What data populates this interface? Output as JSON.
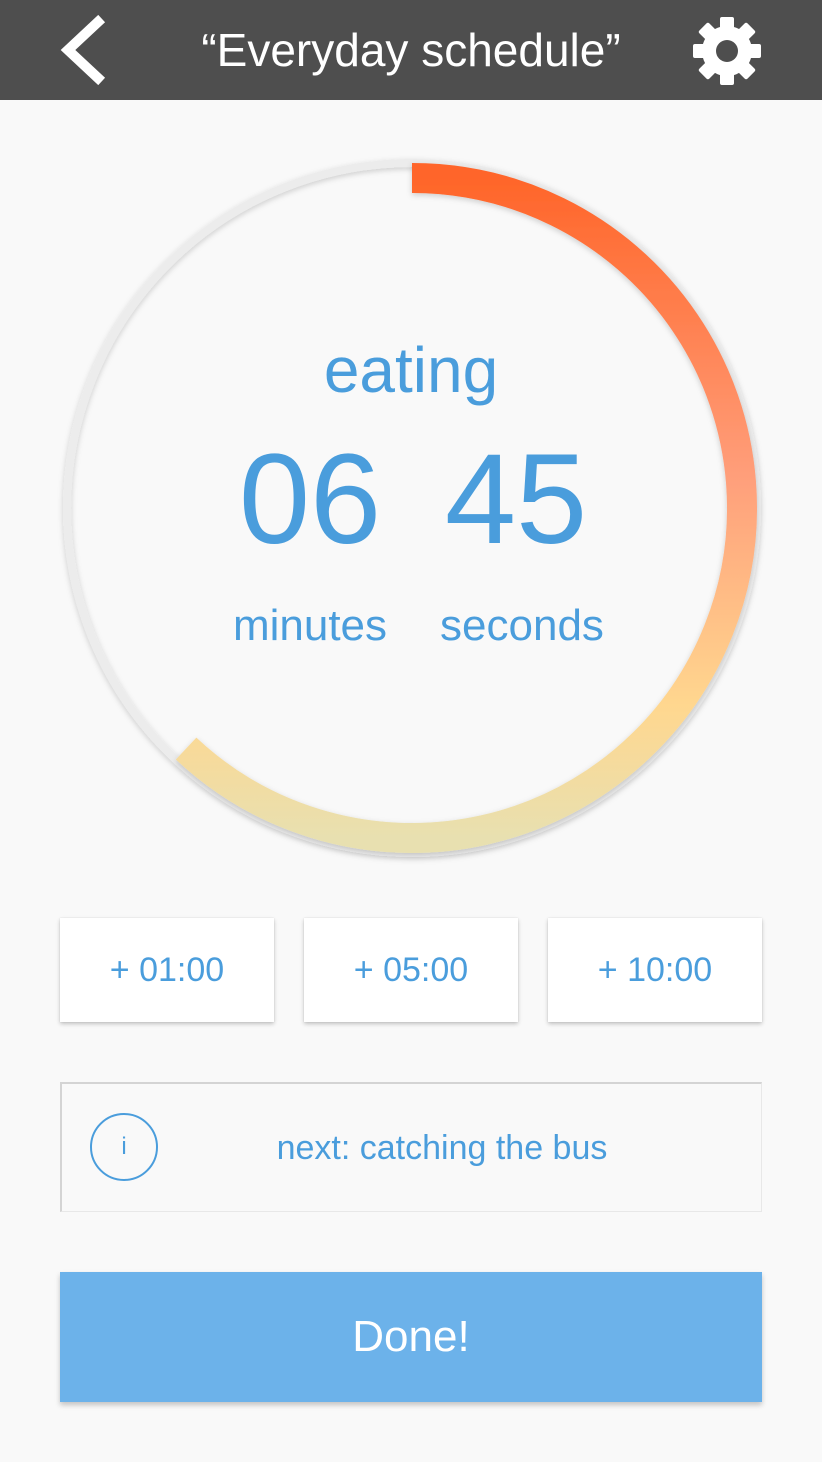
{
  "header": {
    "title": "“Everyday schedule”",
    "back_icon": "chevron-left-icon",
    "settings_icon": "gear-icon",
    "background_color": "#4e4e4e"
  },
  "timer": {
    "activity": "eating",
    "minutes": "06",
    "seconds": "45",
    "minutes_label": "minutes",
    "seconds_label": "seconds",
    "progress_fraction": 0.62,
    "gradient_colors": [
      "#ff6529",
      "#ff9e7a",
      "#ffd78f",
      "#e8e0b0"
    ],
    "track_color": "#ececec"
  },
  "add_time_buttons": [
    {
      "label": "+ 01:00"
    },
    {
      "label": "+ 05:00"
    },
    {
      "label": "+ 10:00"
    }
  ],
  "next": {
    "info_icon": "info-icon",
    "info_glyph": "i",
    "text": "next: catching the bus"
  },
  "done_button": {
    "label": "Done!",
    "color": "#6cb2ea"
  },
  "accent_color": "#4a9ddc"
}
